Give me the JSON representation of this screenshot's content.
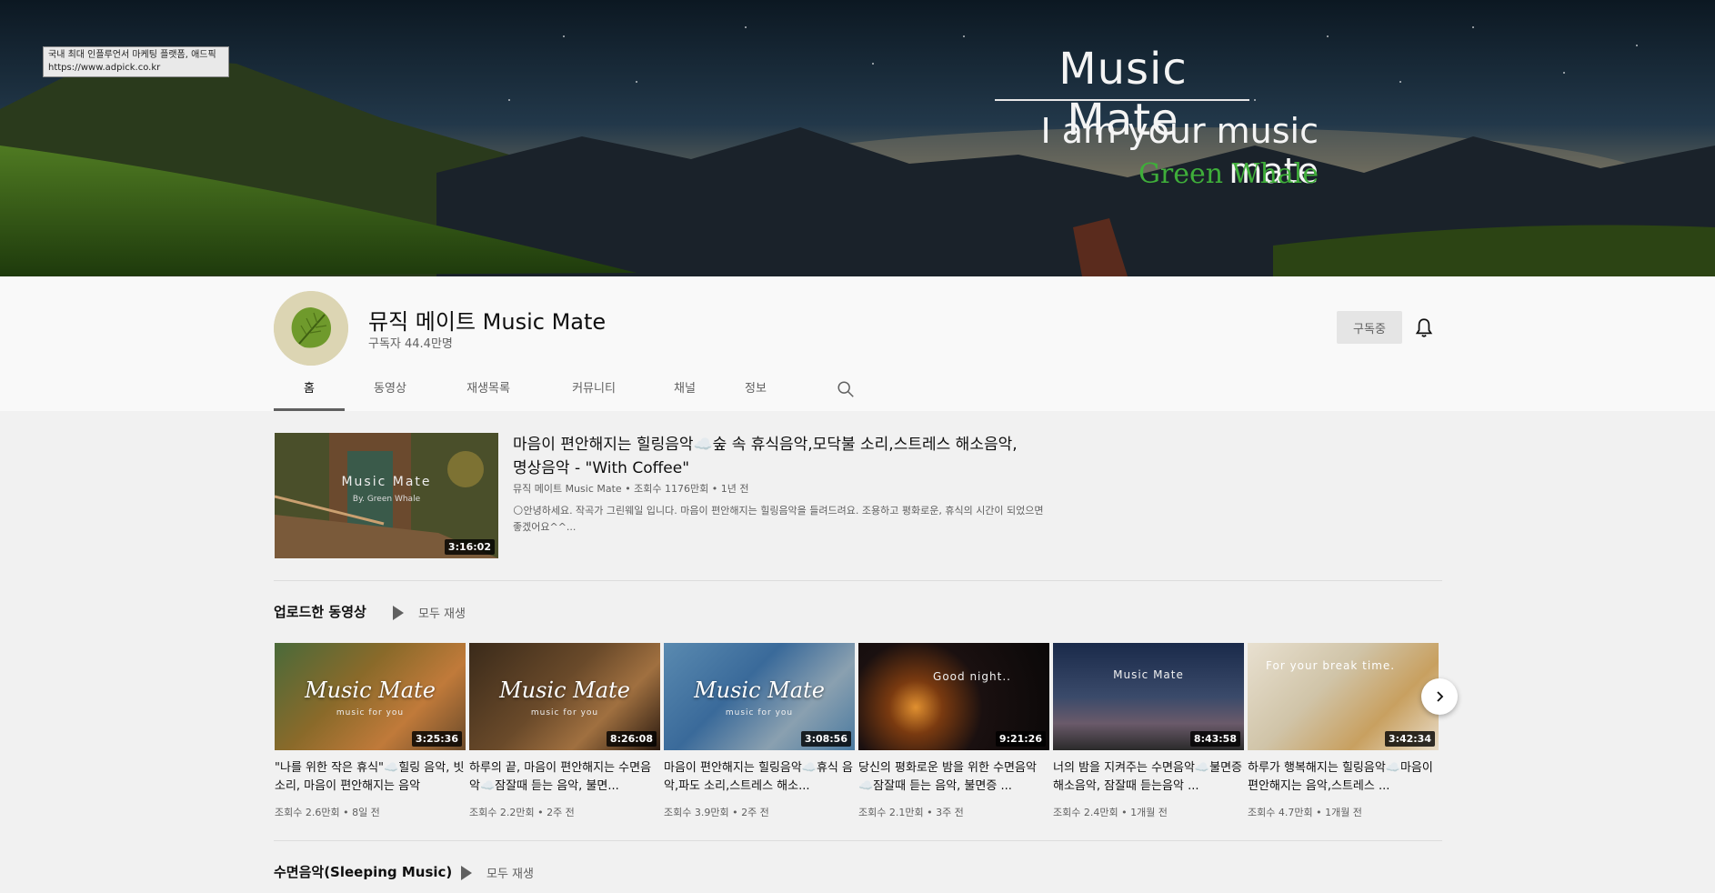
{
  "tooltip": {
    "line1": "국내 최대 인플루언서 마케팅 플랫폼, 애드픽",
    "line2": "https://www.adpick.co.kr"
  },
  "banner": {
    "title": "Music Mate",
    "subtitle": "I am your music mate",
    "signature": "Green Whale"
  },
  "channel": {
    "name": "뮤직 메이트 Music Mate",
    "subscribers": "구독자 44.4만명",
    "subscribe_label": "구독중"
  },
  "tabs": [
    "홈",
    "동영상",
    "재생목록",
    "커뮤니티",
    "채널",
    "정보"
  ],
  "featured": {
    "title_line1": "마음이 편안해지는 힐링음악☁️숲 속 휴식음악,모닥불 소리,스트레스 해소음악,",
    "title_line2": "명상음악 - \"With Coffee\"",
    "meta": "뮤직 메이트 Music Mate • 조회수 1176만회 • 1년 전",
    "desc_line1": "🌕안녕하세요. 작곡가 그린웨일 입니다. 마음이 편안해지는 힐링음악을 들려드려요. 조용하고 평화로운, 휴식의 시간이 되었으면",
    "desc_line2": "좋겠어요^^...",
    "duration": "3:16:02",
    "thumb_text1": "Music Mate",
    "thumb_text2": "By. Green Whale"
  },
  "uploads": {
    "title": "업로드한 동영상",
    "play_all": "모두 재생",
    "videos": [
      {
        "thumb_text": "Music Mate",
        "thumb_sub": "music for you",
        "duration": "3:25:36",
        "title": "\"나를 위한 작은 휴식\"☁️힐링 음악, 빗소리, 마음이 편안해지는 음악",
        "meta": "조회수 2.6만회 • 8일 전"
      },
      {
        "thumb_text": "Music Mate",
        "thumb_sub": "music for you",
        "duration": "8:26:08",
        "title": "하루의 끝, 마음이 편안해지는 수면음악☁️잠잘때 듣는 음악, 불면...",
        "meta": "조회수 2.2만회 • 2주 전"
      },
      {
        "thumb_text": "Music Mate",
        "thumb_sub": "music for you",
        "duration": "3:08:56",
        "title": "마음이 편안해지는 힐링음악☁️휴식 음악,파도 소리,스트레스 해소...",
        "meta": "조회수 3.9만회 • 2주 전"
      },
      {
        "thumb_text": "Good night..",
        "thumb_sub": "",
        "duration": "9:21:26",
        "title": "당신의 평화로운 밤을 위한 수면음악☁️잠잘때 듣는 음악, 불면증 ...",
        "meta": "조회수 2.1만회 • 3주 전"
      },
      {
        "thumb_text": "Music Mate",
        "thumb_sub": "",
        "duration": "8:43:58",
        "title": "너의 밤을 지켜주는 수면음악☁️불면증 해소음악, 잠잘때 듣는음악 ...",
        "meta": "조회수 2.4만회 • 1개월 전"
      },
      {
        "thumb_text": "For your break time.",
        "thumb_sub": "",
        "duration": "3:42:34",
        "title": "하루가 행복해지는 힐링음악☁️마음이 편안해지는 음악,스트레스 ...",
        "meta": "조회수 4.7만회 • 1개월 전"
      }
    ]
  },
  "sleeping": {
    "title": "수면음악(Sleeping Music)",
    "play_all": "모두 재생"
  },
  "icons": {
    "bell": "bell-icon",
    "search": "search-icon",
    "next": "chevron-right-icon",
    "play": "play-icon"
  }
}
